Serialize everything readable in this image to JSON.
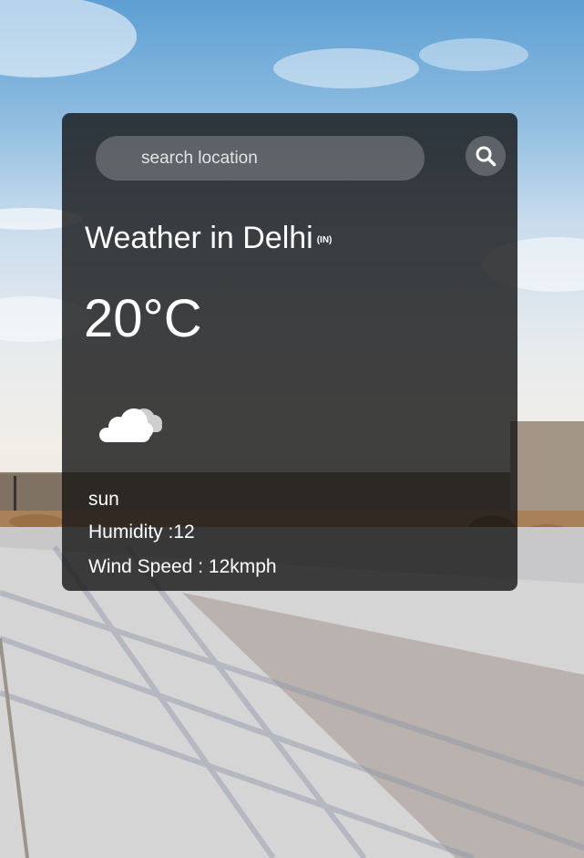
{
  "search": {
    "placeholder": "search location",
    "button_icon": "search-icon"
  },
  "weather": {
    "title": "Weather in Delhi",
    "country_code": "(IN)",
    "temperature": "20°C",
    "icon": "partly-cloudy-icon",
    "description": "sun",
    "humidity": "Humidity :12",
    "wind_speed": "Wind Speed : 12kmph"
  },
  "colors": {
    "card_background": "#141414",
    "text": "#ffffff",
    "input_background": "#5a5a5a"
  }
}
